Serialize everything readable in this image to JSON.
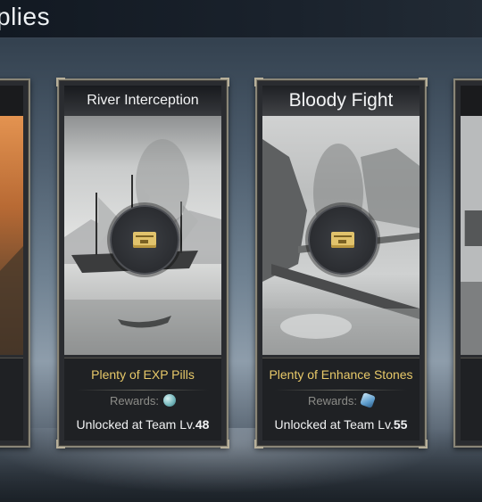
{
  "header": {
    "title": "plies"
  },
  "cards": [
    {
      "title": "River Interception",
      "description": "Plenty of EXP Pills",
      "rewards_label": "Rewards:",
      "reward_icon": "exp-pill-icon",
      "unlock_prefix": "Unlocked at Team Lv.",
      "unlock_level": "48"
    },
    {
      "title": "Bloody Fight",
      "description": "Plenty of Enhance Stones",
      "rewards_label": "Rewards:",
      "reward_icon": "enhance-stone-icon",
      "unlock_prefix": "Unlocked at Team Lv.",
      "unlock_level": "55"
    }
  ],
  "colors": {
    "accent_gold": "#e8c969",
    "card_border": "#8a8678",
    "ticket_gold": "#e1c36c"
  }
}
